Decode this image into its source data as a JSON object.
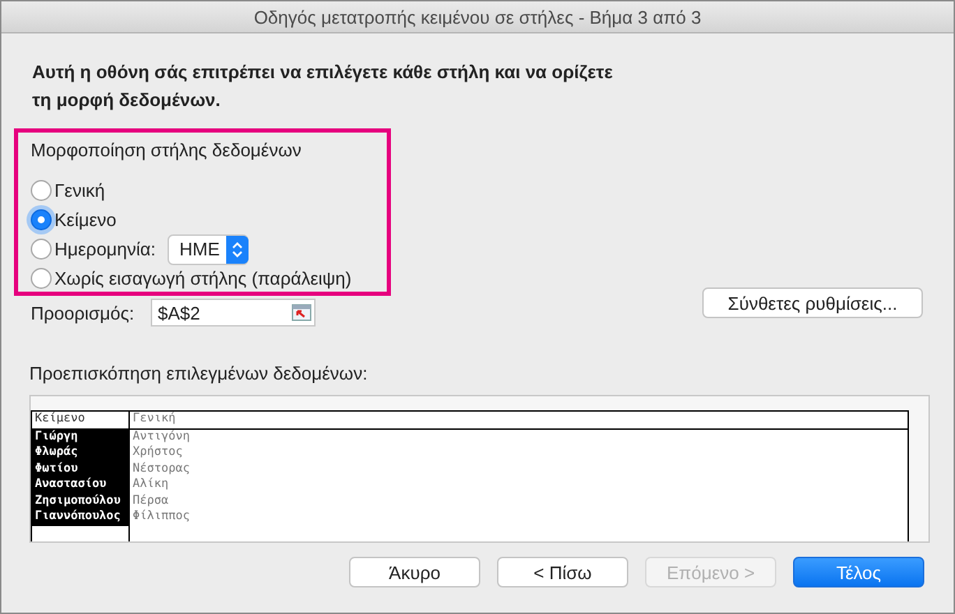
{
  "window": {
    "title": "Οδηγός μετατροπής κειμένου σε στήλες - Βήμα 3 από 3"
  },
  "instructions": "Αυτή η οθόνη σάς επιτρέπει να επιλέγετε κάθε στήλη και να ορίζετε τη μορφή δεδομένων.",
  "format_group": {
    "title": "Μορφοποίηση στήλης δεδομένων",
    "options": [
      {
        "label": "Γενική",
        "selected": false
      },
      {
        "label": "Κείμενο",
        "selected": true
      },
      {
        "label": "Ημερομηνία:",
        "selected": false,
        "dropdown": "ΗΜΕ"
      },
      {
        "label": "Χωρίς εισαγωγή στήλης (παράλειψη)",
        "selected": false
      }
    ]
  },
  "destination": {
    "label": "Προορισμός:",
    "value": "$A$2"
  },
  "advanced_button": "Σύνθετες ρυθμίσεις...",
  "preview": {
    "label": "Προεπισκόπηση επιλεγμένων δεδομένων:",
    "columns": [
      {
        "header": "Κείμενο",
        "selected": true,
        "cells": [
          "Γιώργη",
          "Φλωράς",
          "Φωτίου",
          "Αναστασίου",
          "Ζησιμοπούλου",
          "Γιαννόπουλος"
        ]
      },
      {
        "header": "Γενική",
        "selected": false,
        "cells": [
          "Αντιγόνη",
          "Χρήστος",
          "Νέστορας",
          "Αλίκη",
          "Πέρσα",
          "Φίλιππος"
        ]
      }
    ]
  },
  "buttons": [
    {
      "label": "Άκυρο",
      "kind": "normal"
    },
    {
      "label": "< Πίσω",
      "kind": "normal"
    },
    {
      "label": "Επόμενο >",
      "kind": "disabled"
    },
    {
      "label": "Τέλος",
      "kind": "default"
    }
  ]
}
